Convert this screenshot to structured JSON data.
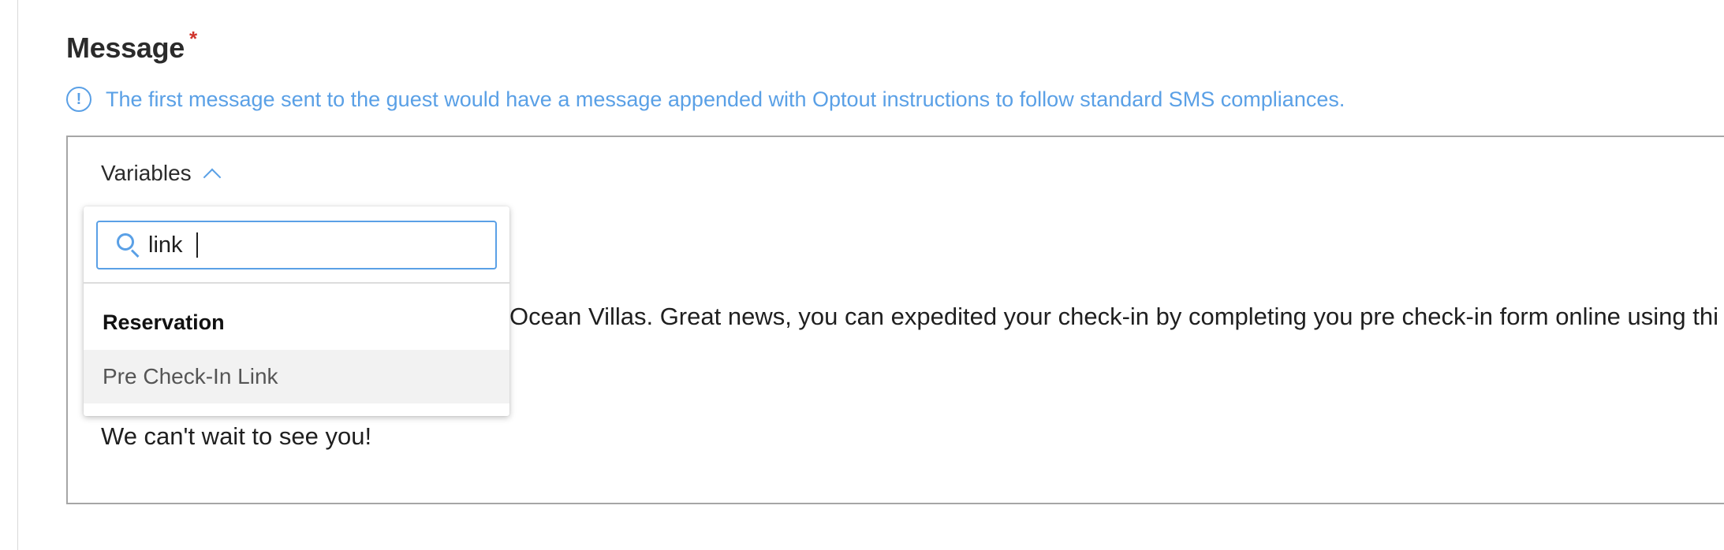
{
  "form": {
    "label": "Message",
    "required_marker": "*",
    "info_icon": "info-circle-icon",
    "info_text": "The first message sent to the guest would have a message appended with Optout instructions to follow standard SMS compliances."
  },
  "editor": {
    "variables_label": "Variables",
    "variables_toggle_icon": "chevron-up-icon",
    "body_line_1": "Ocean Villas.  Great news, you can expedited your check-in by completing you pre check-in form online using thi",
    "body_line_2": "We can't wait to see you!"
  },
  "variables_dropdown": {
    "search_icon": "search-icon",
    "search_value": "link",
    "groups": [
      {
        "name": "Reservation",
        "options": [
          "Pre Check-In Link"
        ]
      }
    ]
  },
  "colors": {
    "accent": "#5aa0e6",
    "required": "#d0342c",
    "option_hover_bg": "#f2f2f2"
  }
}
